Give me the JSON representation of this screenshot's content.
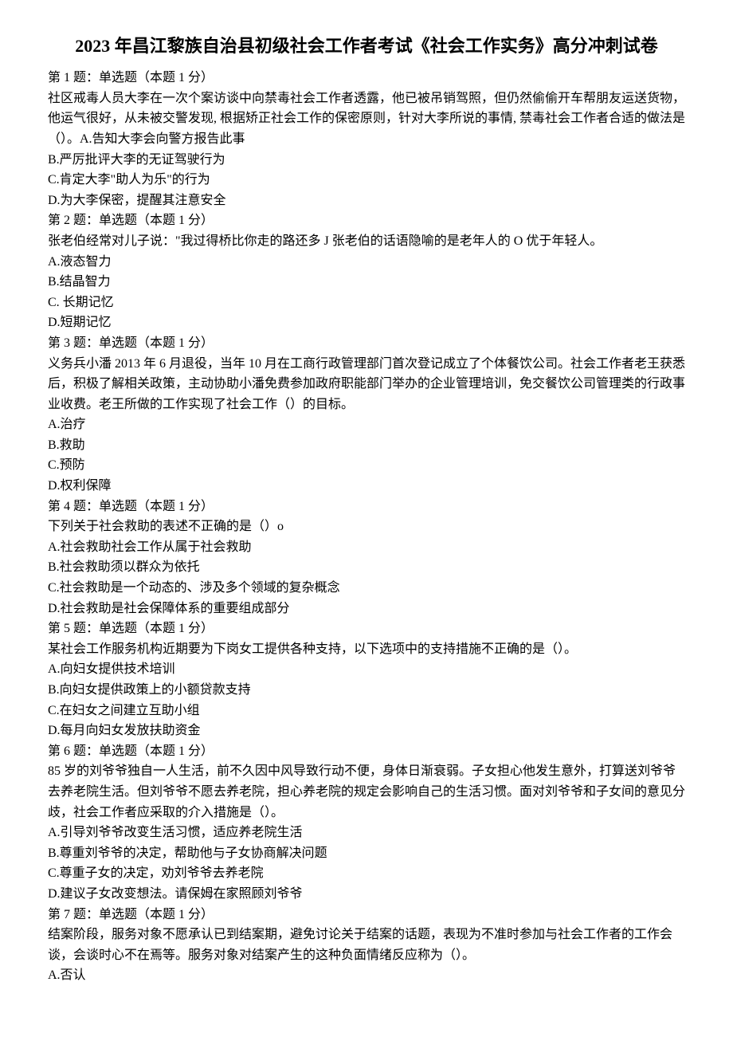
{
  "title": "2023 年昌江黎族自治县初级社会工作者考试《社会工作实务》高分冲刺试卷",
  "questions": [
    {
      "header": "第 1 题：单选题（本题 1 分）",
      "text": "社区戒毒人员大李在一次个案访谈中向禁毒社会工作者透露，他已被吊销驾照，但仍然偷偷开车帮朋友运送货物，他运气很好，从未被交警发现, 根据矫正社会工作的保密原则，针对大李所说的事情, 禁毒社会工作者合适的做法是（）。A.告知大李会向警方报告此事",
      "options": [
        "B.严厉批评大李的无证驾驶行为",
        "C.肯定大李\"助人为乐\"的行为",
        "D.为大李保密，提醒其注意安全"
      ]
    },
    {
      "header": "第 2 题：单选题（本题 1 分）",
      "text": "张老伯经常对儿子说：\"我过得桥比你走的路还多 J 张老伯的话语隐喻的是老年人的 O 优于年轻人。",
      "options": [
        "A.液态智力",
        "B.结晶智力",
        "C. 长期记忆",
        "D.短期记忆"
      ]
    },
    {
      "header": "第 3 题：单选题（本题 1 分）",
      "text": "义务兵小潘 2013 年 6 月退役，当年 10 月在工商行政管理部门首次登记成立了个体餐饮公司。社会工作者老王获悉后，积极了解相关政策，主动协助小潘免费参加政府职能部门举办的企业管理培训，免交餐饮公司管理类的行政事业收费。老王所做的工作实现了社会工作（）的目标。",
      "options": [
        "A.治疗",
        "B.救助",
        "C.预防",
        "D.权利保障"
      ]
    },
    {
      "header": "第 4 题：单选题（本题 1 分）",
      "text": "下列关于社会救助的表述不正确的是（）o",
      "options": [
        "A.社会救助社会工作从属于社会救助",
        "B.社会救助须以群众为依托",
        "C.社会救助是一个动态的、涉及多个领域的复杂概念",
        "D.社会救助是社会保障体系的重要组成部分"
      ]
    },
    {
      "header": "第 5 题：单选题（本题 1 分）",
      "text": "某社会工作服务机构近期要为下岗女工提供各种支持，以下选项中的支持措施不正确的是（）。",
      "options": [
        "A.向妇女提供技术培训",
        "B.向妇女提供政策上的小额贷款支持",
        "C.在妇女之间建立互助小组",
        "D.每月向妇女发放扶助资金"
      ]
    },
    {
      "header": "第 6 题：单选题（本题 1 分）",
      "text": "85 岁的刘爷爷独自一人生活，前不久因中风导致行动不便，身体日渐衰弱。子女担心他发生意外，打算送刘爷爷去养老院生活。但刘爷爷不愿去养老院，担心养老院的规定会影响自己的生活习惯。面对刘爷爷和子女间的意见分歧，社会工作者应采取的介入措施是（）。",
      "options": [
        "A.引导刘爷爷改变生活习惯，适应养老院生活",
        "B.尊重刘爷爷的决定，帮助他与子女协商解决问题",
        "C.尊重子女的决定，劝刘爷爷去养老院",
        "D.建议子女改变想法。请保姆在家照顾刘爷爷"
      ]
    },
    {
      "header": "第 7 题：单选题（本题 1 分）",
      "text": "结案阶段，服务对象不愿承认已到结案期，避免讨论关于结案的话题，表现为不准时参加与社会工作者的工作会谈，会谈时心不在焉等。服务对象对结案产生的这种负面情绪反应称为（）。",
      "options": [
        "A.否认"
      ]
    }
  ]
}
